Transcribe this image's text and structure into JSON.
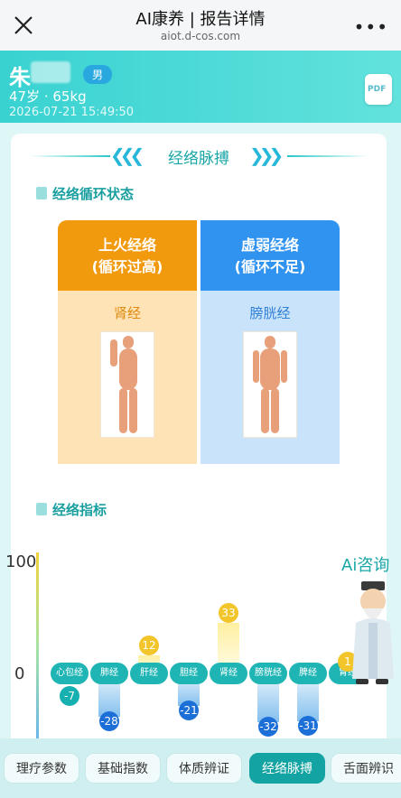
{
  "topbar": {
    "title": "AI康养 | 报告详情",
    "url": "aiot.d-cos.com"
  },
  "patient": {
    "name": "朱",
    "gender": "男",
    "meta": "47岁 · 65kg",
    "time": "2026-07-21 15:49:50"
  },
  "pdf_label": "PDF",
  "section_title": "经络脉搏",
  "status_title": "经络循环状态",
  "status": [
    {
      "head": "上火经络\n(循环过高)",
      "head_line1": "上火经络",
      "head_line2": "(循环过高)",
      "meridian": "肾经",
      "color": "#f19a0d",
      "bg": "#fde3b5",
      "text_color": "#e08a10"
    },
    {
      "head_line1": "虚弱经络",
      "head_line2": "(循环不足)",
      "meridian": "膀胱经",
      "color": "#2f93ef",
      "bg": "#c9e3fb",
      "text_color": "#2f7fd6"
    }
  ],
  "indicator_title": "经络指标",
  "chart_data": {
    "type": "bar",
    "categories": [
      "心包经",
      "肺经",
      "肝经",
      "胆经",
      "肾经",
      "膀胱经",
      "脾经",
      "胃经"
    ],
    "values": [
      -7,
      -28,
      12,
      -21,
      33,
      -32,
      -31,
      1
    ],
    "ytick_labels": [
      "100",
      "0"
    ],
    "ylim": [
      -100,
      100
    ]
  },
  "ai_consult": "Ai咨询",
  "tabs": [
    {
      "label": "理疗参数",
      "active": false
    },
    {
      "label": "基础指数",
      "active": false
    },
    {
      "label": "体质辨证",
      "active": false
    },
    {
      "label": "经络脉搏",
      "active": true
    },
    {
      "label": "舌面辨识",
      "active": false
    }
  ]
}
